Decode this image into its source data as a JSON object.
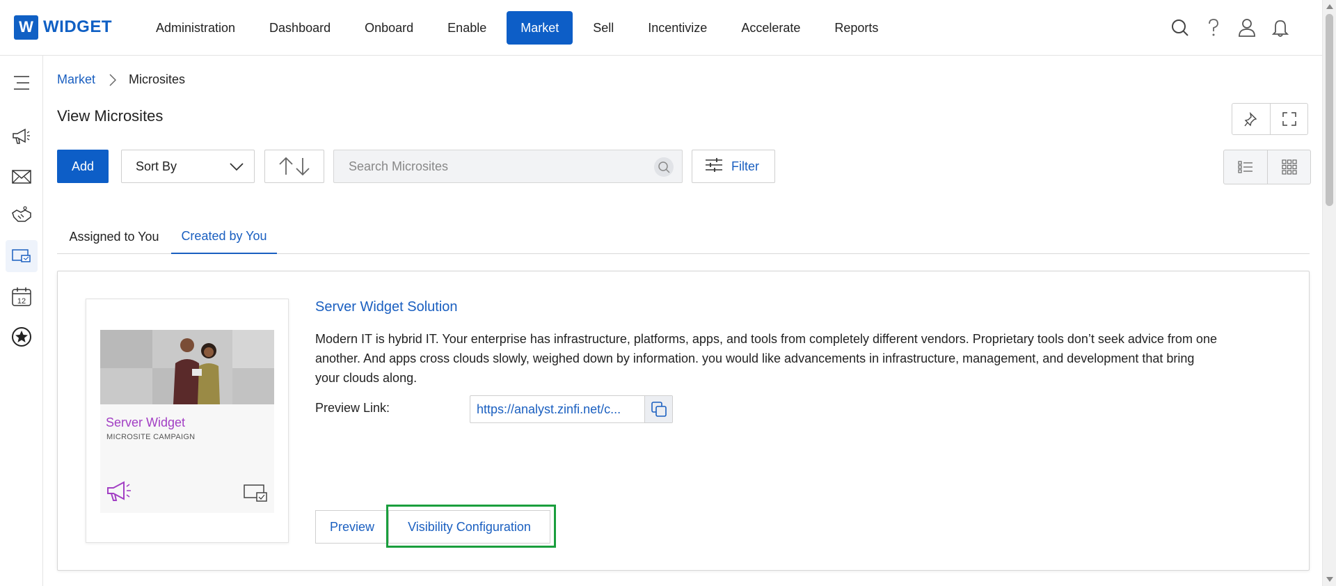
{
  "brand": {
    "logo_letter": "W",
    "name": "WIDGET"
  },
  "nav": {
    "items": [
      {
        "label": "Administration",
        "active": false
      },
      {
        "label": "Dashboard",
        "active": false
      },
      {
        "label": "Onboard",
        "active": false
      },
      {
        "label": "Enable",
        "active": false
      },
      {
        "label": "Market",
        "active": true
      },
      {
        "label": "Sell",
        "active": false
      },
      {
        "label": "Incentivize",
        "active": false
      },
      {
        "label": "Accelerate",
        "active": false
      },
      {
        "label": "Reports",
        "active": false
      }
    ]
  },
  "top_icons": [
    "search-icon",
    "help-icon",
    "user-icon",
    "bell-icon"
  ],
  "rail": [
    "menu-icon",
    "megaphone-icon",
    "mail-icon",
    "handshake-icon",
    "microsite-icon",
    "calendar-icon",
    "star-icon"
  ],
  "rail_calendar_number": "12",
  "breadcrumb": {
    "parent": "Market",
    "current": "Microsites"
  },
  "page": {
    "title": "View Microsites"
  },
  "toolbar": {
    "add_label": "Add",
    "sort_label": "Sort By",
    "search_placeholder": "Search Microsites",
    "filter_label": "Filter"
  },
  "tabs": [
    {
      "label": "Assigned to You",
      "active": false
    },
    {
      "label": "Created by You",
      "active": true
    }
  ],
  "card": {
    "title": "Server Widget Solution",
    "description": "Modern IT is hybrid IT. Your enterprise has infrastructure, platforms, apps, and tools from completely different vendors. Proprietary tools don’t seek advice from one another. And apps cross clouds slowly, weighed down by information. you would like advancements in infrastructure, management, and development that bring your clouds along.",
    "preview_label": "Preview Link:",
    "preview_url": "https://analyst.zinfi.net/c...",
    "thumb_title": "Server Widget",
    "thumb_subtitle": "MICROSITE CAMPAIGN",
    "preview_button": "Preview",
    "visibility_button": "Visibility Configuration"
  },
  "colors": {
    "accent": "#0d5ec7",
    "link": "#1a5fc0",
    "highlight": "#1a9e3d",
    "thumb_title": "#a23fc4"
  }
}
